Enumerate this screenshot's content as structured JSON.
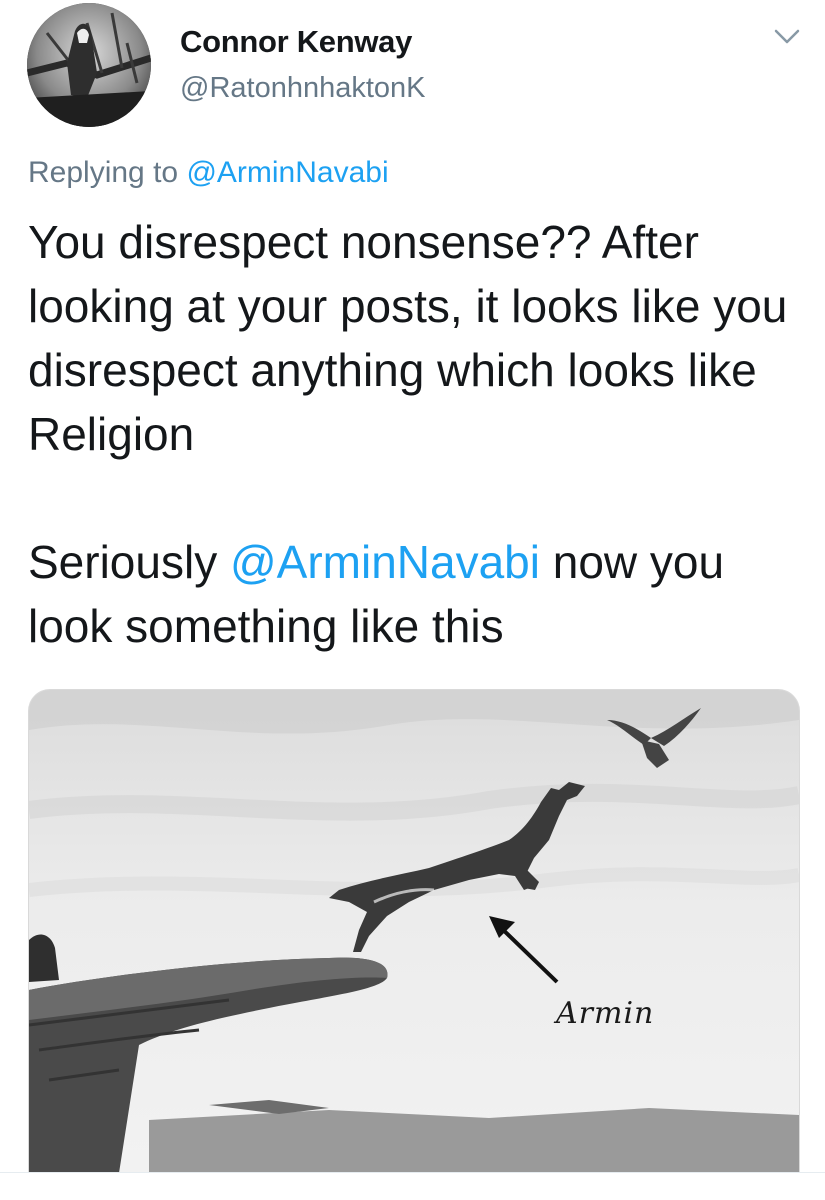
{
  "tweet": {
    "author": {
      "display_name": "Connor Kenway",
      "handle": "@RatonhnhaktonK"
    },
    "reply": {
      "prefix": "Replying to",
      "mention": "@ArminNavabi"
    },
    "text": {
      "paragraph1": "You disrespect nonsense?? After looking at your posts, it looks like you disrespect anything which looks like Religion",
      "paragraph2_before": "Seriously ",
      "paragraph2_mention": "@ArminNavabi",
      "paragraph2_after": " now you look something like this"
    },
    "media": {
      "caption": "Armin"
    },
    "menu_icon": "chevron-down-icon",
    "colors": {
      "text": "#14171a",
      "secondary": "#657786",
      "link": "#1da1f2"
    }
  }
}
